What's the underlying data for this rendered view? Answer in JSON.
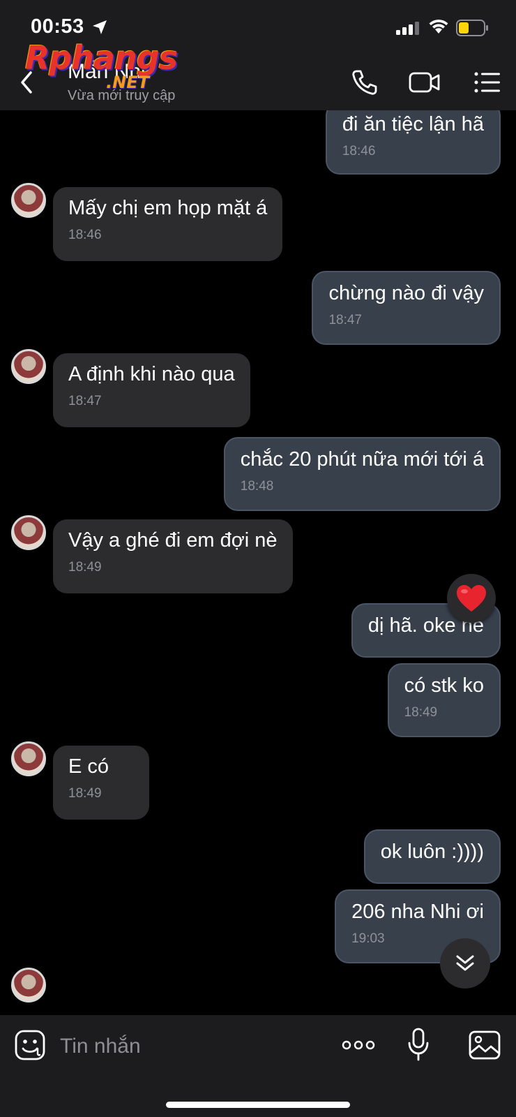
{
  "status_bar": {
    "time": "00:53"
  },
  "watermark": {
    "main": "Rphangs",
    "sub": ".NET"
  },
  "header": {
    "contact_name": "Mẫn Nhi",
    "contact_status": "Vừa mới truy cập"
  },
  "messages": [
    {
      "direction": "out",
      "text": "đi ăn tiệc lận hã",
      "time": "18:46"
    },
    {
      "direction": "in",
      "text": "Mấy chị em họp mặt á",
      "time": "18:46"
    },
    {
      "direction": "out",
      "text": "chừng nào đi vậy",
      "time": "18:47"
    },
    {
      "direction": "in",
      "text": "A định khi nào qua",
      "time": "18:47"
    },
    {
      "direction": "out",
      "text": "chắc 20 phút nữa mới tới á",
      "time": "18:48"
    },
    {
      "direction": "in",
      "text": "Vậy a ghé đi em đợi nè",
      "time": "18:49"
    },
    {
      "direction": "out",
      "text": "dị hã. oke nè",
      "time": "",
      "reaction": "heart"
    },
    {
      "direction": "out",
      "text": "có stk ko",
      "time": "18:49"
    },
    {
      "direction": "in",
      "text": "E có",
      "time": "18:49"
    },
    {
      "direction": "out",
      "text": "ok luôn :))))",
      "time": ""
    },
    {
      "direction": "out",
      "text": "206 nha Nhi ơi",
      "time": "19:03"
    }
  ],
  "composer": {
    "placeholder": "Tin nhắn"
  },
  "colors": {
    "background": "#000000",
    "incoming_bubble": "#2c2c2e",
    "outgoing_bubble": "#38404c",
    "reaction_heart": "#e8242e"
  }
}
